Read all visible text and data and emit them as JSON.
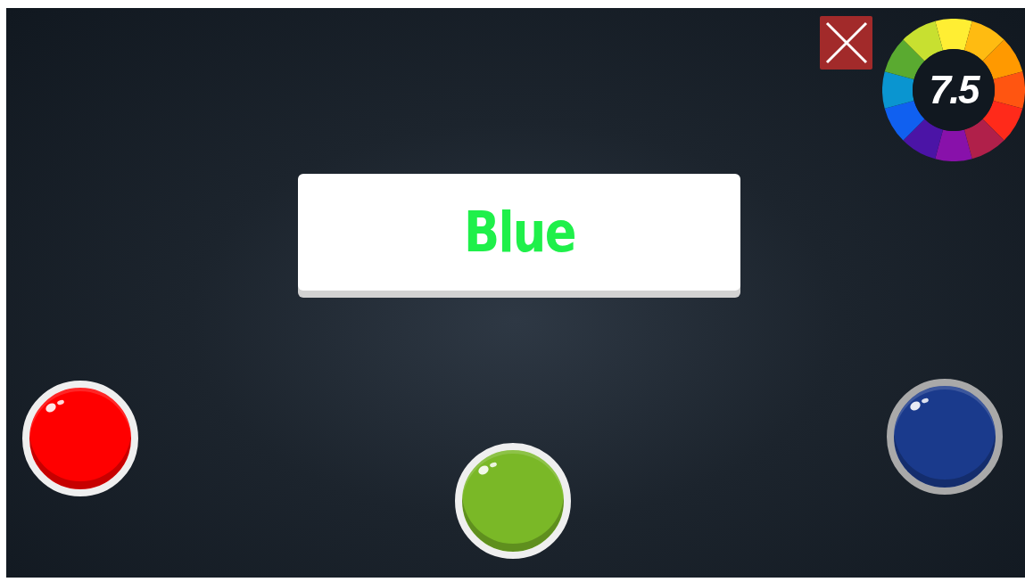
{
  "score": "7.5",
  "word_card": {
    "text": "Blue",
    "color": "#1ff04a"
  },
  "color_buttons": [
    {
      "color": "#ff0000",
      "dimmed": false
    },
    {
      "color": "#7ab827",
      "dimmed": false
    },
    {
      "color": "#1a3a8c",
      "dimmed": true
    }
  ]
}
